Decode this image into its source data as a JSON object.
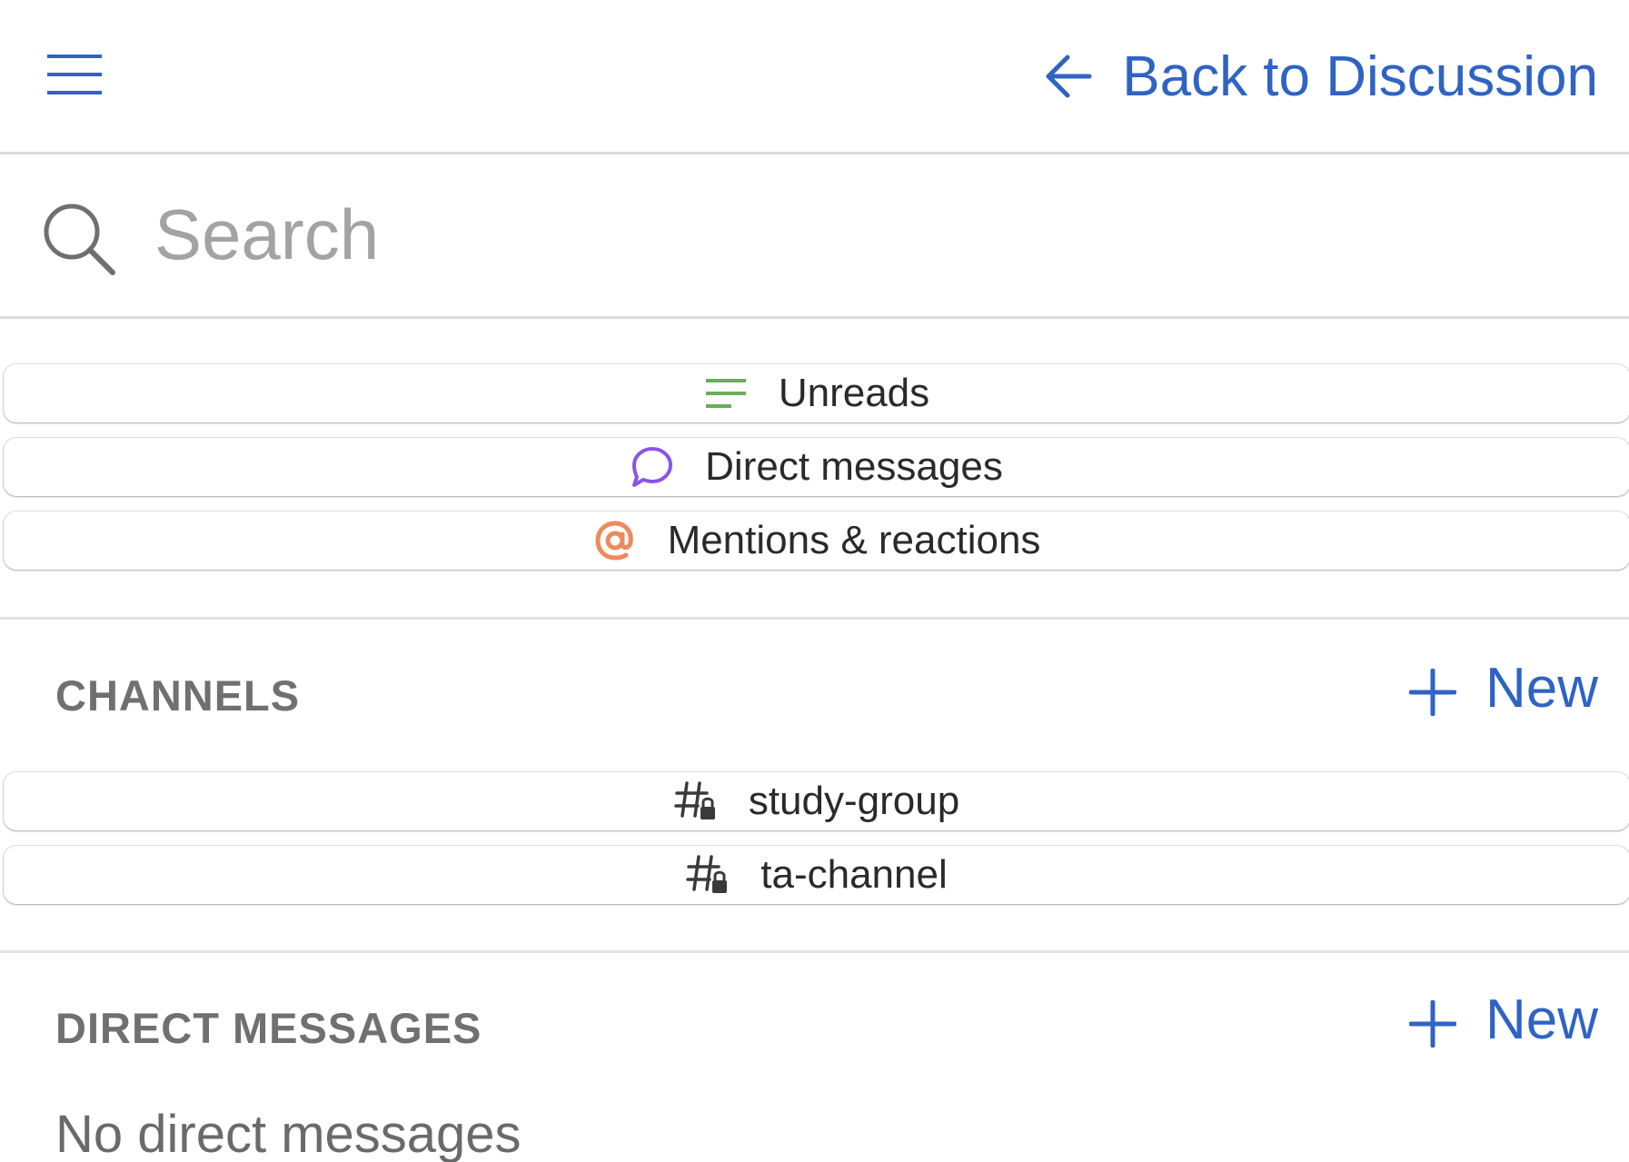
{
  "header": {
    "menu_icon": "hamburger-menu-icon",
    "back_label": "Back to Discussion",
    "back_icon": "arrow-left-icon",
    "accent_color": "#2f63c4"
  },
  "search": {
    "placeholder": "Search",
    "value": ""
  },
  "quick_links": [
    {
      "label": "Unreads",
      "icon": "list-icon",
      "icon_color": "#6aae5a"
    },
    {
      "label": "Direct messages",
      "icon": "chat-bubble-icon",
      "icon_color": "#8a55e6"
    },
    {
      "label": "Mentions & reactions",
      "icon": "at-sign-icon",
      "icon_color": "#ec8a5e"
    }
  ],
  "channels": {
    "title": "CHANNELS",
    "new_label": "New",
    "items": [
      {
        "label": "study-group",
        "icon": "private-channel-icon"
      },
      {
        "label": "ta-channel",
        "icon": "private-channel-icon"
      }
    ]
  },
  "direct_messages": {
    "title": "DIRECT MESSAGES",
    "new_label": "New",
    "empty_text": "No direct messages"
  }
}
